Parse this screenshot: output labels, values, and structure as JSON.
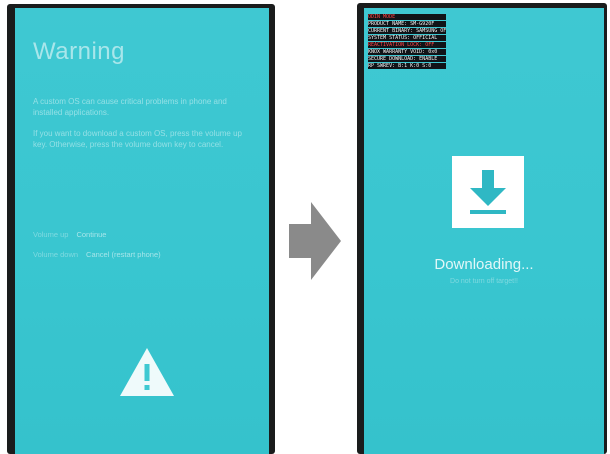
{
  "warning_screen": {
    "title": "Warning",
    "paragraphs": [
      "A custom OS can cause critical problems in phone and installed applications.",
      "If you want to download a custom OS, press the volume up key. Otherwise, press the volume down key to cancel."
    ],
    "key_rows": [
      {
        "key": "Volume up",
        "action": "Continue"
      },
      {
        "key": "Volume down",
        "action": "Cancel (restart phone)"
      }
    ],
    "icon": "warning-triangle-icon"
  },
  "transition_icon": "right-arrow-icon",
  "download_screen": {
    "debug_lines": [
      {
        "text": "ODIN MODE",
        "color": "#ff4545"
      },
      {
        "text": "PRODUCT NAME: SM-G920F",
        "color": "#f2f2f2"
      },
      {
        "text": "CURRENT BINARY: SAMSUNG OFFICIAL",
        "color": "#f2f2f2"
      },
      {
        "text": "SYSTEM STATUS: OFFICIAL",
        "color": "#f2f2f2"
      },
      {
        "text": "REACTIVATION LOCK: OFF",
        "color": "#ff4545"
      },
      {
        "text": "KNOX WARRANTY VOID: 0x0",
        "color": "#f2f2f2"
      },
      {
        "text": "SECURE DOWNLOAD: ENABLE",
        "color": "#f2f2f2"
      },
      {
        "text": "RP SWREV: B:1 K:0 S:0",
        "color": "#f2f2f2"
      }
    ],
    "icon": "download-icon",
    "status_label": "Downloading...",
    "status_sub": "Do not turn off target!!",
    "colors": {
      "screen": "#3ec9d2",
      "accent": "#2fb8c4",
      "icon_bg": "#ffffff"
    }
  }
}
